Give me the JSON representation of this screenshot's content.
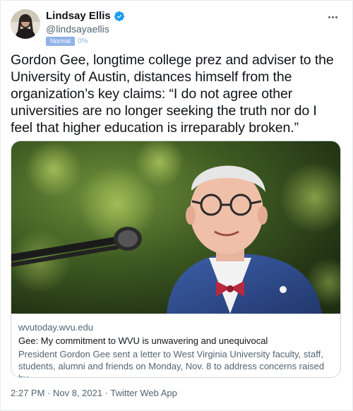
{
  "author": {
    "display_name": "Lindsay Ellis",
    "handle": "@lindsayaellis",
    "badge": "Normal",
    "percent": "0%",
    "verified": true,
    "icons": [
      "avatar",
      "verified-badge-icon",
      "more-options-icon"
    ]
  },
  "tweet": {
    "text": "Gordon Gee, longtime college prez and adviser to the University of Austin, distances himself from the organization’s key claims: “I do not agree other universities are no longer seeking the truth nor do I feel that higher education is irreparably broken.”"
  },
  "card": {
    "domain": "wvutoday.wvu.edu",
    "title": "Gee: My commitment to WVU is unwavering and unequivocal",
    "description": "President Gordon Gee sent a letter to West Virginia University faculty, staff, students, alumni and friends on Monday, Nov. 8 to address concerns raised by …"
  },
  "footer": {
    "time": "2:27 PM",
    "date": "Nov 8, 2021",
    "source": "Twitter Web App",
    "separator": " · "
  },
  "colors": {
    "text": "#0f1419",
    "secondary": "#536471",
    "verified": "#1d9bf0",
    "badge": "#8fb3e8",
    "border": "#cfd9de"
  }
}
